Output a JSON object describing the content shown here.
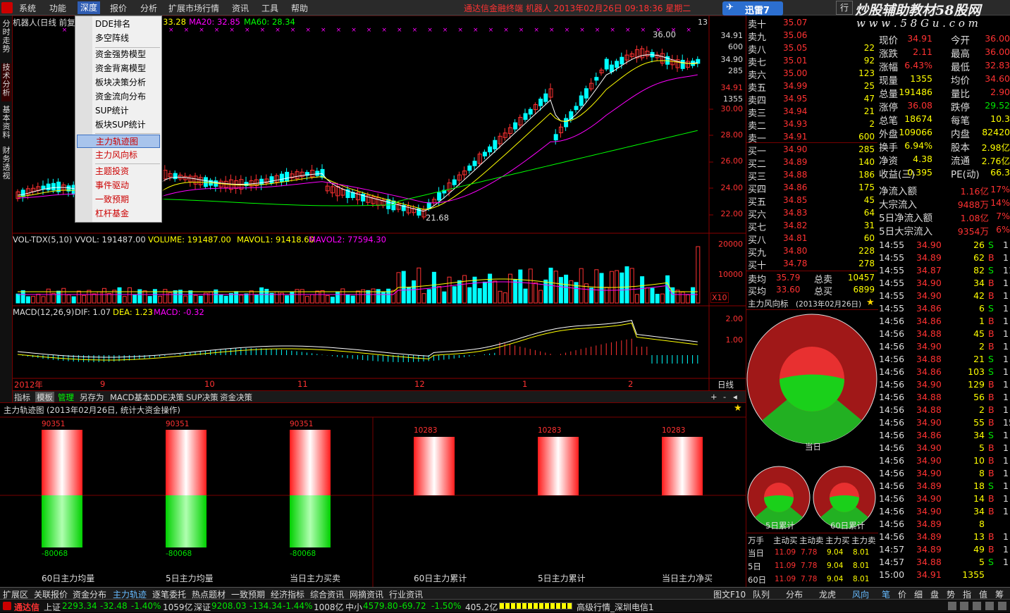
{
  "menu": [
    "系统",
    "功能",
    "深度",
    "报价",
    "分析",
    "扩展市场行情",
    "资讯",
    "工具",
    "帮助"
  ],
  "ticker": "通达信金融终端 机器人 2013年02月26日 09:18:36 星期二",
  "xunlei": "迅雷7",
  "watermark1": "炒股辅助教材58股网",
  "watermark2": "w w w . 5 8 G u . c o m",
  "side_tabs": [
    "分时走势",
    "技术分析",
    "基本资料",
    "财务透视"
  ],
  "dropdown": {
    "items": [
      "DDE排名",
      "多空阵线",
      "资金强势模型",
      "资金背离模型",
      "板块决策分析",
      "资金流向分布",
      "SUP统计",
      "板块SUP统计",
      "主力轨迹图",
      "主力风向标",
      "主题投资",
      "事件驱动",
      "一致预期",
      "杠杆基金"
    ],
    "selected": "主力轨迹图"
  },
  "kline": {
    "title": "机器人(日线 前复",
    "ma_text": "33.28",
    "ma20": "MA20: 32.85",
    "ma60": "MA60: 28.34",
    "yticks": [
      "34.91",
      "600",
      "34.90",
      "285",
      "34.91",
      "1355",
      "30.00",
      "28.00",
      "26.00",
      "24.00",
      "22.00"
    ],
    "high_label": "36.00",
    "low_label": "21.68",
    "flag": "13"
  },
  "volume": {
    "title": "VOL-TDX(5,10)",
    "vvol": "VVOL: 191487.00",
    "volume": "VOLUME: 191487.00",
    "mavol1": "MAVOL1: 91418.60",
    "mavol2": "MAVOL2: 77594.30",
    "yticks": [
      "20000",
      "10000"
    ],
    "unit": "X10"
  },
  "macd": {
    "title": "MACD(12,26,9)",
    "dif": "DIF: 1.07",
    "dea": "DEA: 1.23",
    "macd": "MACD: -0.32",
    "yticks": [
      "2.00",
      "1.00"
    ]
  },
  "xaxis": [
    "2012年",
    "9",
    "10",
    "11",
    "12",
    "1",
    "2"
  ],
  "period": "日线",
  "bottom_tabs": [
    "指标",
    "模板",
    "管理",
    "另存为",
    "MACD基本",
    "DDE决策",
    "SUP决策",
    "资金决策"
  ],
  "zhuli": {
    "title": "主力轨迹图",
    "subtitle": "(2013年02月26日, 统计大资金操作)",
    "bars": [
      {
        "top": "90351",
        "bottom": "-80068",
        "label": "60日主力均量",
        "has_green": true
      },
      {
        "top": "90351",
        "bottom": "-80068",
        "label": "5日主力均量",
        "has_green": true
      },
      {
        "top": "90351",
        "bottom": "-80068",
        "label": "当日主力买卖",
        "has_green": true
      },
      {
        "top": "10283",
        "bottom": "",
        "label": "60日主力累计",
        "has_green": false
      },
      {
        "top": "10283",
        "bottom": "",
        "label": "5日主力累计",
        "has_green": false
      },
      {
        "top": "10283",
        "bottom": "",
        "label": "当日主力净买",
        "has_green": false
      }
    ]
  },
  "bottom_bar": [
    "扩展区",
    "关联报价",
    "资金分布",
    "主力轨迹",
    "逐笔委托",
    "热点题材",
    "一致预期",
    "经济指标",
    "综合资讯",
    "网摘资讯",
    "行业资讯"
  ],
  "bottom_right": [
    "图文F10",
    "队列",
    "分布",
    "龙虎",
    "风向"
  ],
  "right_bottom_tabs": [
    "笔",
    "价",
    "细",
    "盘",
    "势",
    "指",
    "值",
    "筹"
  ],
  "status": {
    "brand": "通达信",
    "sh_label": "上证",
    "sh": "2293.34",
    "sh_chg": "-32.48",
    "sh_pct": "-1.40%",
    "sh_amt": "1059亿",
    "sz_label": "深证",
    "sz": "9208.03",
    "sz_chg": "-134.34",
    "sz_pct": "-1.44%",
    "sz_amt": "1008亿",
    "zx_label": "中小",
    "zx": "4579.80",
    "zx_chg": "-69.72",
    "zx_pct": "-1.50%",
    "zx_amt": "405.2亿",
    "server": "高级行情_深圳电信1"
  },
  "sell": [
    {
      "label": "卖十",
      "price": "35.07",
      "vol": ""
    },
    {
      "label": "卖九",
      "price": "35.06",
      "vol": ""
    },
    {
      "label": "卖八",
      "price": "35.05",
      "vol": "22"
    },
    {
      "label": "卖七",
      "price": "35.01",
      "vol": "92"
    },
    {
      "label": "卖六",
      "price": "35.00",
      "vol": "123"
    },
    {
      "label": "卖五",
      "price": "34.99",
      "vol": "25"
    },
    {
      "label": "卖四",
      "price": "34.95",
      "vol": "47"
    },
    {
      "label": "卖三",
      "price": "34.94",
      "vol": "21"
    },
    {
      "label": "卖二",
      "price": "34.93",
      "vol": "2"
    },
    {
      "label": "卖一",
      "price": "34.91",
      "vol": "600"
    }
  ],
  "buy": [
    {
      "label": "买一",
      "price": "34.90",
      "vol": "285"
    },
    {
      "label": "买二",
      "price": "34.89",
      "vol": "140"
    },
    {
      "label": "买三",
      "price": "34.88",
      "vol": "186"
    },
    {
      "label": "买四",
      "price": "34.86",
      "vol": "175"
    },
    {
      "label": "买五",
      "price": "34.85",
      "vol": "45"
    },
    {
      "label": "买六",
      "price": "34.83",
      "vol": "64"
    },
    {
      "label": "买七",
      "price": "34.82",
      "vol": "31"
    },
    {
      "label": "买八",
      "price": "34.81",
      "vol": "60"
    },
    {
      "label": "买九",
      "price": "34.80",
      "vol": "228"
    },
    {
      "label": "买十",
      "price": "34.78",
      "vol": "278"
    }
  ],
  "avg": [
    {
      "label": "卖均",
      "price": "35.79",
      "k": "总卖",
      "v": "10457"
    },
    {
      "label": "买均",
      "price": "33.60",
      "k": "总买",
      "v": "6899"
    }
  ],
  "info": [
    {
      "a": "现价",
      "b": "34.91",
      "c": "今开",
      "d": "36.00"
    },
    {
      "a": "涨跌",
      "b": "2.11",
      "c": "最高",
      "d": "36.00"
    },
    {
      "a": "涨幅",
      "b": "6.43%",
      "c": "最低",
      "d": "32.83"
    },
    {
      "a": "现量",
      "b": "1355",
      "c": "均价",
      "d": "34.60"
    },
    {
      "a": "总量",
      "b": "191486",
      "c": "量比",
      "d": "2.90"
    },
    {
      "a": "涨停",
      "b": "36.08",
      "c": "跌停",
      "d": "29.52"
    },
    {
      "a": "总笔",
      "b": "18674",
      "c": "每笔",
      "d": "10.3"
    },
    {
      "a": "外盘",
      "b": "109066",
      "c": "内盘",
      "d": "82420"
    },
    {
      "a": "换手",
      "b": "6.94%",
      "c": "股本",
      "d": "2.98亿"
    },
    {
      "a": "净资",
      "b": "4.38",
      "c": "流通",
      "d": "2.76亿"
    },
    {
      "a": "收益(三)",
      "b": "0.395",
      "c": "PE(动)",
      "d": "66.3"
    }
  ],
  "flows": [
    {
      "a": "净流入额",
      "b": "1.16亿",
      "c": "17%"
    },
    {
      "a": "大宗流入",
      "b": "9488万",
      "c": "14%"
    },
    {
      "a": "5日净流入额",
      "b": "1.08亿",
      "c": "7%"
    },
    {
      "a": "5日大宗流入",
      "b": "9354万",
      "c": "6%"
    }
  ],
  "ticks": [
    [
      "14:55",
      "34.90",
      "26",
      "S",
      "1"
    ],
    [
      "14:55",
      "34.89",
      "62",
      "B",
      "1"
    ],
    [
      "14:55",
      "34.87",
      "82",
      "S",
      "11"
    ],
    [
      "14:55",
      "34.90",
      "34",
      "B",
      "1"
    ],
    [
      "14:55",
      "34.90",
      "42",
      "B",
      "1"
    ],
    [
      "14:55",
      "34.86",
      "6",
      "S",
      "1"
    ],
    [
      "14:56",
      "34.86",
      "1",
      "B",
      "1"
    ],
    [
      "14:56",
      "34.88",
      "45",
      "B",
      "1"
    ],
    [
      "14:56",
      "34.90",
      "2",
      "B",
      "1"
    ],
    [
      "14:56",
      "34.88",
      "21",
      "S",
      "1"
    ],
    [
      "14:56",
      "34.86",
      "103",
      "S",
      "1"
    ],
    [
      "14:56",
      "34.90",
      "129",
      "B",
      "1"
    ],
    [
      "14:56",
      "34.88",
      "56",
      "B",
      "1"
    ],
    [
      "14:56",
      "34.88",
      "2",
      "B",
      "1"
    ],
    [
      "14:56",
      "34.90",
      "55",
      "B",
      "15"
    ],
    [
      "14:56",
      "34.86",
      "34",
      "S",
      "1"
    ],
    [
      "14:56",
      "34.90",
      "5",
      "B",
      "1"
    ],
    [
      "14:56",
      "34.90",
      "10",
      "B",
      "1"
    ],
    [
      "14:56",
      "34.90",
      "8",
      "B",
      "1"
    ],
    [
      "14:56",
      "34.89",
      "18",
      "S",
      "1"
    ],
    [
      "14:56",
      "34.90",
      "14",
      "B",
      "1"
    ],
    [
      "14:56",
      "34.90",
      "34",
      "B",
      "1"
    ],
    [
      "14:56",
      "34.89",
      "8",
      "",
      ""
    ],
    [
      "14:56",
      "34.89",
      "13",
      "B",
      "1"
    ],
    [
      "14:57",
      "34.89",
      "49",
      "B",
      "1"
    ],
    [
      "14:57",
      "34.88",
      "5",
      "S",
      "1"
    ],
    [
      "15:00",
      "34.91",
      "1355",
      "",
      ""
    ]
  ],
  "feng": {
    "title": "主力风向标",
    "date": "(2013年02月26日)",
    "labels": [
      "当日",
      "5日累计",
      "60日累计"
    ],
    "table_head": [
      "万手",
      "主动买",
      "主动卖",
      "主力买",
      "主力卖"
    ],
    "rows": [
      {
        "k": "当日",
        "v": [
          "11.09",
          "7.78",
          "9.04",
          "8.01"
        ]
      },
      {
        "k": "5日",
        "v": [
          "11.09",
          "7.78",
          "9.04",
          "8.01"
        ]
      },
      {
        "k": "60日",
        "v": [
          "11.09",
          "7.78",
          "9.04",
          "8.01"
        ]
      }
    ]
  }
}
